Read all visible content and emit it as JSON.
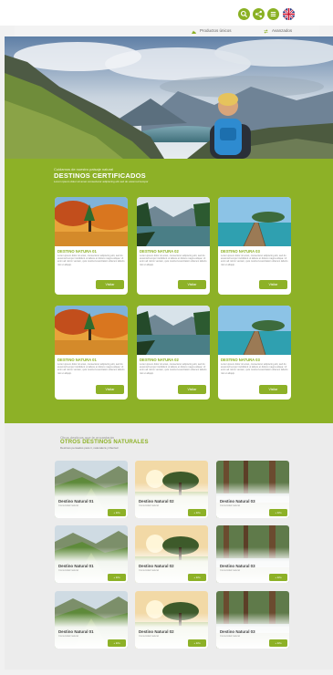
{
  "colors": {
    "accent": "#8db127",
    "section_bg": "#ececec"
  },
  "top_icons": [
    {
      "name": "search-icon"
    },
    {
      "name": "share-icon"
    },
    {
      "name": "menu-icon"
    },
    {
      "name": "uk-flag-icon"
    }
  ],
  "subnav": {
    "items": [
      {
        "label": "Productos únicos",
        "icon": "mountain-icon"
      },
      {
        "label": "Avanzados",
        "icon": "arrows-icon"
      }
    ]
  },
  "certified": {
    "eyebrow": "Cuidamos de nuestro paisaje natural",
    "title": "DESTINOS CERTIFICADOS",
    "subtitle": "Lorem ipsum dolor sit amet consectetur adipiscing elit sed do eiusmod tempor",
    "cards": [
      {
        "title": "DESTINO NATURA 01",
        "text": "Lorem ipsum dolor sit amet, consectetur adipiscing elit, sed do eiusmod tempor incididunt ut labore et dolore magna aliqua. Ut enim ad minim veniam, quis nostrud exercitation ullamco laboris nisi ut aliquip.",
        "button": "Visitar",
        "image": "autumn"
      },
      {
        "title": "DESTINO NATURA 02",
        "text": "Lorem ipsum dolor sit amet, consectetur adipiscing elit, sed do eiusmod tempor incididunt ut labore et dolore magna aliqua. Ut enim ad minim veniam, quis nostrud exercitation ullamco laboris nisi ut aliquip.",
        "button": "Visitar",
        "image": "lake"
      },
      {
        "title": "DESTINO NATURA 03",
        "text": "Lorem ipsum dolor sit amet, consectetur adipiscing elit, sed do eiusmod tempor incididunt ut labore et dolore magna aliqua. Ut enim ad minim veniam, quis nostrud exercitation ullamco laboris nisi ut aliquip.",
        "button": "Visitar",
        "image": "pier"
      },
      {
        "title": "DESTINO NATURA 01",
        "text": "Lorem ipsum dolor sit amet, consectetur adipiscing elit, sed do eiusmod tempor incididunt ut labore et dolore magna aliqua. Ut enim ad minim veniam, quis nostrud exercitation ullamco laboris nisi ut aliquip.",
        "button": "Visitar",
        "image": "autumn"
      },
      {
        "title": "DESTINO NATURA 02",
        "text": "Lorem ipsum dolor sit amet, consectetur adipiscing elit, sed do eiusmod tempor incididunt ut labore et dolore magna aliqua. Ut enim ad minim veniam, quis nostrud exercitation ullamco laboris nisi ut aliquip.",
        "button": "Visitar",
        "image": "lake"
      },
      {
        "title": "DESTINO NATURA 03",
        "text": "Lorem ipsum dolor sit amet, consectetur adipiscing elit, sed do eiusmod tempor incididunt ut labore et dolore magna aliqua. Ut enim ad minim veniam, quis nostrud exercitation ullamco laboris nisi ut aliquip.",
        "button": "Visitar",
        "image": "pier"
      }
    ]
  },
  "other": {
    "eyebrow": "Otros destinos que te encantarán",
    "title": "OTROS DESTINOS NATURALES",
    "subtitle": "Destinos pensados para ti, naturaleza y libertad",
    "cards": [
      {
        "title": "Destino Natural 01",
        "subtitle": "Comunidad natural",
        "button": "+ Info",
        "image": "valley"
      },
      {
        "title": "Destino Natural 02",
        "subtitle": "Comunidad natural",
        "button": "+ Info",
        "image": "tree"
      },
      {
        "title": "Destino Natural 03",
        "subtitle": "Comunidad natural",
        "button": "+ Info",
        "image": "forest"
      },
      {
        "title": "Destino Natural 01",
        "subtitle": "Comunidad natural",
        "button": "+ Info",
        "image": "valley"
      },
      {
        "title": "Destino Natural 02",
        "subtitle": "Comunidad natural",
        "button": "+ Info",
        "image": "tree"
      },
      {
        "title": "Destino Natural 03",
        "subtitle": "Comunidad natural",
        "button": "+ Info",
        "image": "forest"
      },
      {
        "title": "Destino Natural 01",
        "subtitle": "Comunidad natural",
        "button": "+ Info",
        "image": "valley"
      },
      {
        "title": "Destino Natural 02",
        "subtitle": "Comunidad natural",
        "button": "+ Info",
        "image": "tree"
      },
      {
        "title": "Destino Natural 03",
        "subtitle": "Comunidad natural",
        "button": "+ Info",
        "image": "forest"
      }
    ]
  }
}
